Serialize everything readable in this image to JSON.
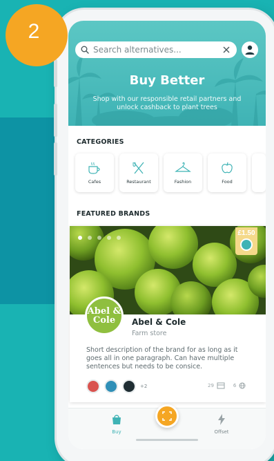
{
  "step_number": "2",
  "colors": {
    "teal": "#3fb3b5",
    "orange": "#f5a623",
    "background": "#19b3b3"
  },
  "search": {
    "placeholder": "Search alternatives..."
  },
  "hero": {
    "title": "Buy Better",
    "subtitle": "Shop with our responsible retail partners and unlock cashback to plant trees"
  },
  "categories": {
    "heading": "CATEGORIES",
    "items": [
      {
        "label": "Cafes",
        "icon": "coffee-cup-icon"
      },
      {
        "label": "Restaurant",
        "icon": "cutlery-icon"
      },
      {
        "label": "Fashion",
        "icon": "hanger-icon"
      },
      {
        "label": "Food",
        "icon": "apple-icon"
      }
    ]
  },
  "featured": {
    "heading": "FEATURED BRANDS",
    "carousel": {
      "slides": 5,
      "active": 1
    },
    "brand": {
      "cashback": "£1.50",
      "logo_text": "Abel & Cole",
      "name": "Abel & Cole",
      "type": "Farm store",
      "description": "Short description of the brand for as long as it goes all in one paragraph. Can have multiple sentences but needs to be consice.",
      "extra_badges": "+2",
      "stores_count": "29",
      "web_count": "6"
    }
  },
  "nav": {
    "buy_label": "Buy",
    "offset_label": "Offset"
  }
}
